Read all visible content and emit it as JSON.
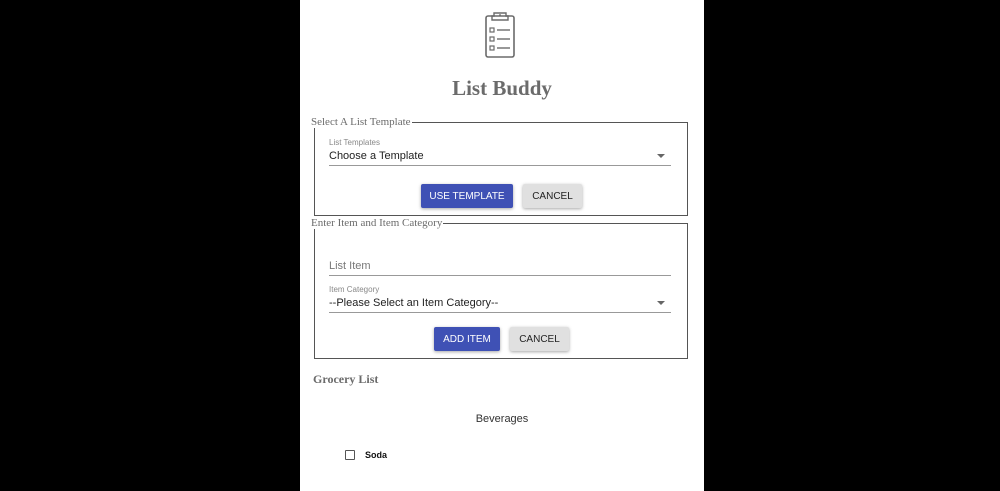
{
  "header": {
    "title": "List Buddy",
    "logo_icon": "clipboard-list-icon"
  },
  "template_section": {
    "legend": "Select A List Template",
    "select_label": "List Templates",
    "select_value": "Choose a Template",
    "use_button": "USE TEMPLATE",
    "cancel_button": "CANCEL"
  },
  "item_section": {
    "legend": "Enter Item and Item Category",
    "item_placeholder": "List Item",
    "category_label": "Item Category",
    "category_value": "--Please Select an Item Category--",
    "add_button": "ADD ITEM",
    "cancel_button": "CANCEL"
  },
  "grocery_list": {
    "title": "Grocery List",
    "categories": [
      {
        "name": "Beverages",
        "items": [
          {
            "label": "Soda",
            "checked": false
          }
        ]
      }
    ]
  },
  "colors": {
    "primary": "#3f51b5",
    "secondary": "#e0e0e0",
    "background": "#000000"
  }
}
